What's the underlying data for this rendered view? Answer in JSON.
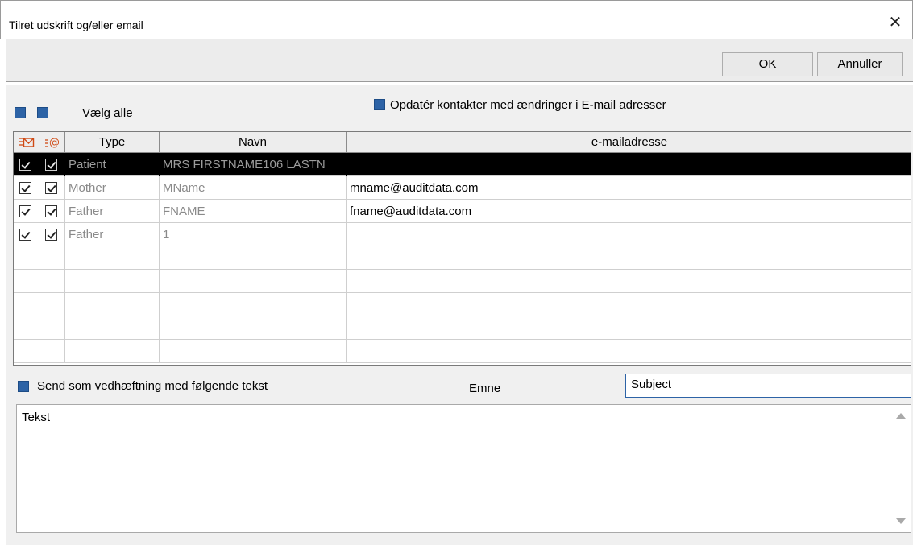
{
  "window": {
    "title": "Tilret udskrift og/eller email",
    "close_glyph": "✕"
  },
  "toolbar": {
    "ok_label": "OK",
    "cancel_label": "Annuller"
  },
  "select_all": {
    "label": "Vælg alle"
  },
  "update_contacts": {
    "label": "Opdatér kontakter med ændringer i E-mail adresser"
  },
  "table": {
    "columns": [
      "",
      "",
      "Type",
      "Navn",
      "e-mailadresse"
    ],
    "header_icons": [
      "print-select-icon",
      "email-select-icon"
    ],
    "rows": [
      {
        "type": "Patient",
        "name": "MRS FIRSTNAME106 LASTN",
        "email": "",
        "selected": true
      },
      {
        "type": "Mother",
        "name": "MName",
        "email": "mname@auditdata.com",
        "selected": false
      },
      {
        "type": "Father",
        "name": "FNAME",
        "email": "fname@auditdata.com",
        "selected": false
      },
      {
        "type": "Father",
        "name": "1",
        "email": "",
        "selected": false
      }
    ]
  },
  "attachment": {
    "label": "Send som vedhæftning med følgende tekst"
  },
  "subject": {
    "label": "Emne",
    "value": "Subject"
  },
  "body": {
    "value": "Tekst"
  },
  "colors": {
    "accent": "#2d63a6",
    "selected_row": "#000000"
  }
}
